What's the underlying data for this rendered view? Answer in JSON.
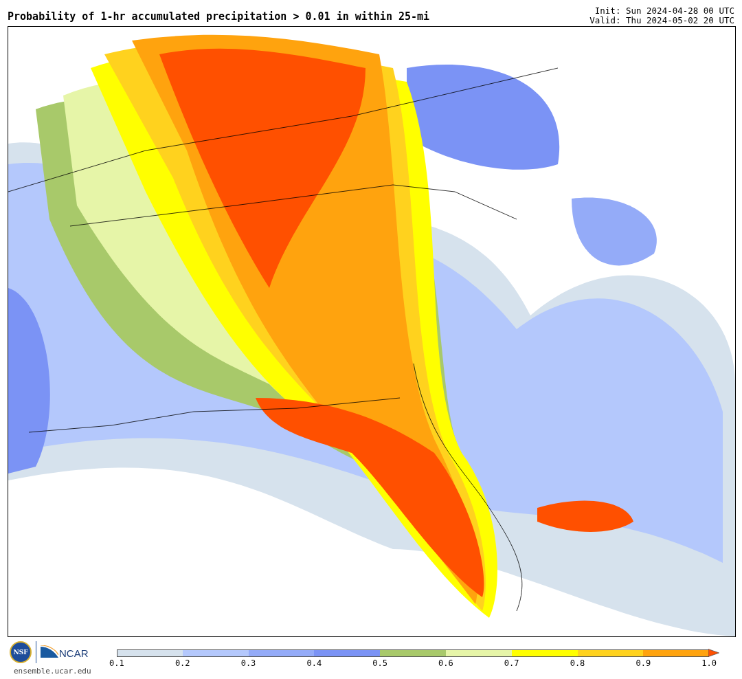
{
  "title": "Probability of 1-hr accumulated precipitation > 0.01 in within 25-mi",
  "run_info": [
    "Init: Sun 2024-04-28 00 UTC",
    "Valid: Thu 2024-05-02 20 UTC"
  ],
  "logos": {
    "nsf": "NSF",
    "ncar": "NCAR",
    "url": "ensemble.ucar.edu"
  },
  "colorbar": {
    "bins": [
      {
        "color": "#d6e2ed"
      },
      {
        "color": "#b4c8fc"
      },
      {
        "color": "#94abf8"
      },
      {
        "color": "#7b93f5"
      },
      {
        "color": "#a8c96a"
      },
      {
        "color": "#e6f5a8"
      },
      {
        "color": "#ffff00"
      },
      {
        "color": "#ffd21e"
      },
      {
        "color": "#ffa30e"
      }
    ],
    "overflow": {
      "color": "#ff5000"
    },
    "ticks": [
      "0.1",
      "0.2",
      "0.3",
      "0.4",
      "0.5",
      "0.6",
      "0.7",
      "0.8",
      "0.9",
      "1.0"
    ]
  }
}
